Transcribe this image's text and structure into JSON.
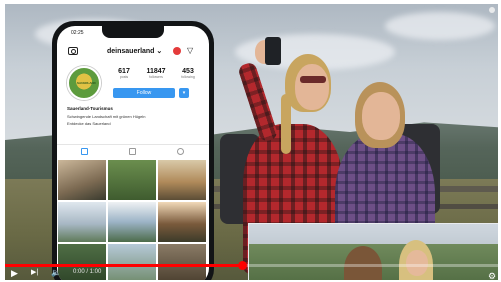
{
  "video": {
    "phone": {
      "status_time": "02:25",
      "username": "deinsauerland",
      "username_chevron": "⌄",
      "avatar_text": "SAUERLAND",
      "stats": [
        {
          "value": "617",
          "label": "posts"
        },
        {
          "value": "11847",
          "label": "followers"
        },
        {
          "value": "453",
          "label": "following"
        }
      ],
      "follow_label": "Follow",
      "follow_more": "▾",
      "bio_name": "Sauerland-Tourismus",
      "bio_lines": [
        "Schwingende Landschaft mit grünen Hügeln",
        "Entdecke das Sauerland"
      ],
      "icons": {
        "camera": "camera-icon",
        "notification": "notification-icon",
        "send": "send-icon"
      }
    },
    "player": {
      "progress_fraction": 0.48,
      "time_text": "0:00 / 1:00",
      "play_glyph": "▶",
      "next_glyph": "▶|",
      "volume_glyph": "🔈",
      "settings_glyph": "⚙"
    },
    "colors": {
      "progress": "#ff0000",
      "follow": "#3897f0"
    }
  }
}
